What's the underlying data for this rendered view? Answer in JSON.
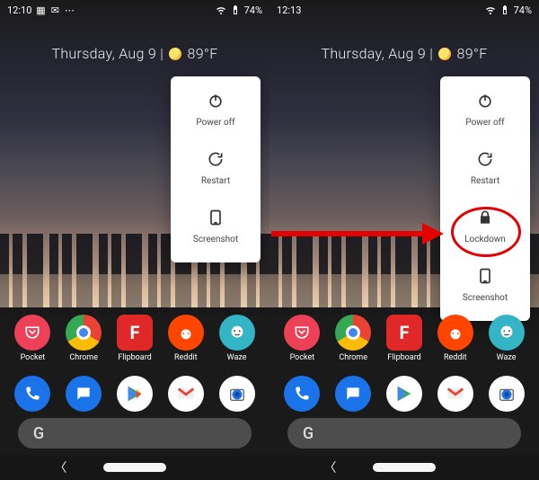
{
  "left": {
    "status": {
      "time": "12:10",
      "battery": "74%"
    },
    "date": "Thursday, Aug 9",
    "temp": "89°F",
    "power_menu": [
      {
        "key": "power-off",
        "label": "Power off"
      },
      {
        "key": "restart",
        "label": "Restart"
      },
      {
        "key": "screenshot",
        "label": "Screenshot"
      }
    ],
    "apps_row1": [
      {
        "name": "Pocket"
      },
      {
        "name": "Chrome"
      },
      {
        "name": "Flipboard"
      },
      {
        "name": "Reddit"
      },
      {
        "name": "Waze"
      }
    ]
  },
  "right": {
    "status": {
      "time": "12:13",
      "battery": "74%"
    },
    "date": "Thursday, Aug 9",
    "temp": "89°F",
    "power_menu": [
      {
        "key": "power-off",
        "label": "Power off"
      },
      {
        "key": "restart",
        "label": "Restart"
      },
      {
        "key": "lockdown",
        "label": "Lockdown"
      },
      {
        "key": "screenshot",
        "label": "Screenshot"
      }
    ],
    "apps_row1": [
      {
        "name": "Pocket"
      },
      {
        "name": "Chrome"
      },
      {
        "name": "Flipboard"
      },
      {
        "name": "Reddit"
      },
      {
        "name": "Waze"
      }
    ]
  },
  "search_letter": "G"
}
